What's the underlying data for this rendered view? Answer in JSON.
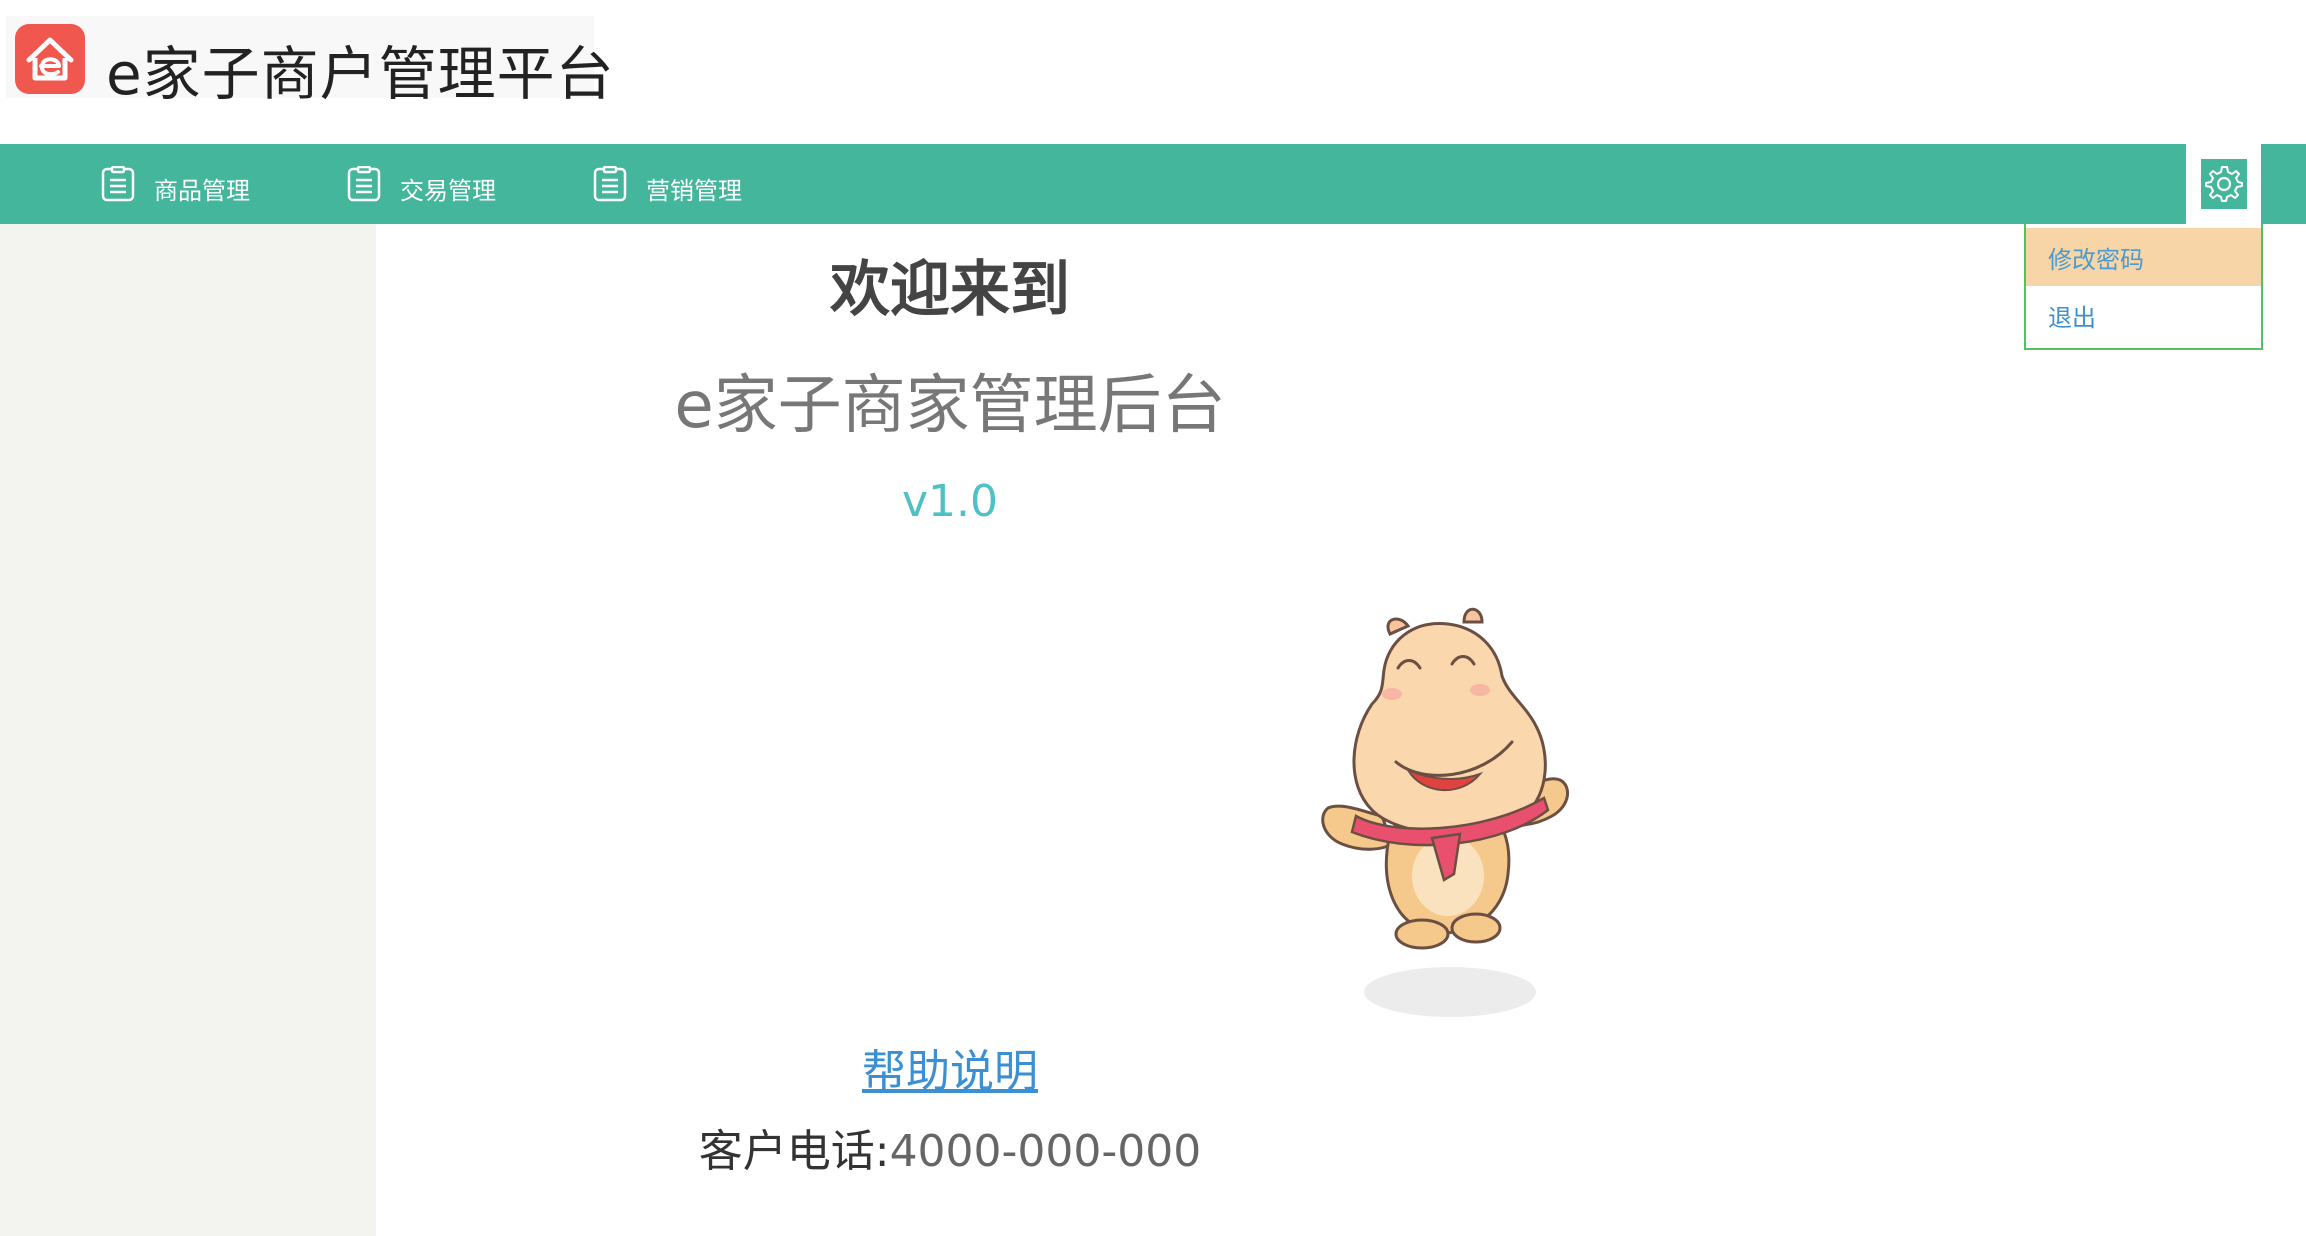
{
  "header": {
    "logo_icon": "e-home-logo-icon",
    "title": "e家子商户管理平台"
  },
  "navbar": {
    "items": [
      {
        "label": "商品管理",
        "icon": "clipboard-icon"
      },
      {
        "label": "交易管理",
        "icon": "clipboard-icon"
      },
      {
        "label": "营销管理",
        "icon": "clipboard-icon"
      }
    ],
    "settings_icon": "gear-icon"
  },
  "dropdown": {
    "items": [
      {
        "label": "修改密码",
        "active": true
      },
      {
        "label": "退出",
        "active": false
      }
    ]
  },
  "main": {
    "welcome": "欢迎来到",
    "subtitle": "e家子商家管理后台",
    "version": "v1.0",
    "mascot": "hippo-mascot-image",
    "help_link": "帮助说明",
    "phone_label": "客户电话:",
    "phone_value": "4000-000-000"
  },
  "colors": {
    "nav_bg": "#44b69c",
    "logo_red": "#f0584f",
    "link_blue": "#3b8fd3",
    "version_teal": "#4fc1c4",
    "dropdown_active": "#f7d5a7",
    "dropdown_border": "#55c05f",
    "sidebar_bg": "#f3f3f0"
  }
}
